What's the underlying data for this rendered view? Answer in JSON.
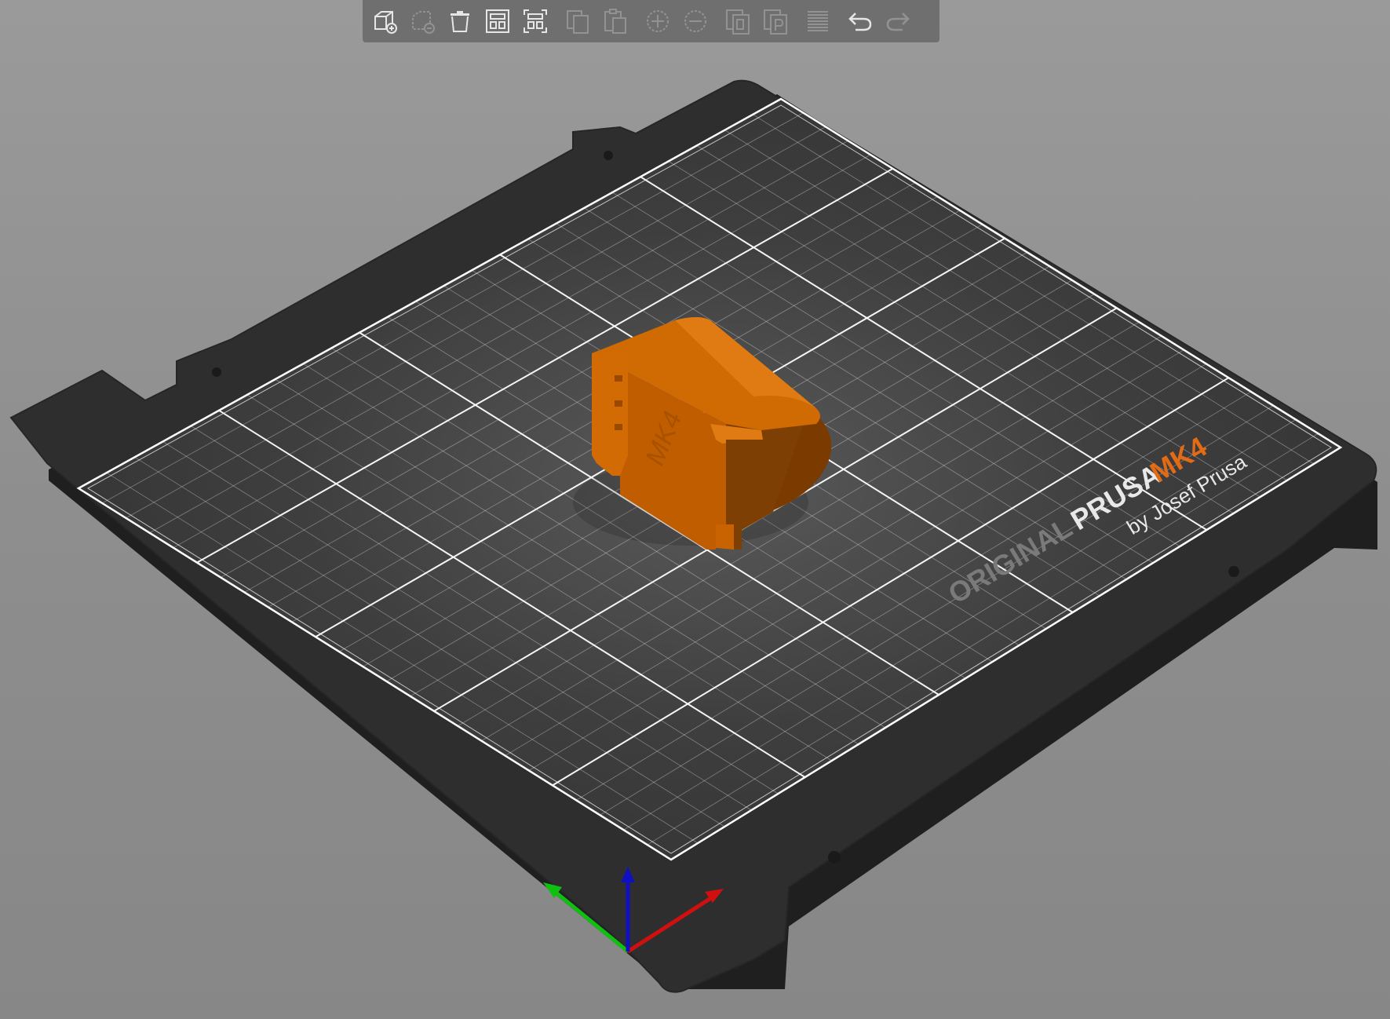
{
  "bed": {
    "brand_original": "ORIGINAL",
    "brand_prusa": "PRUSA",
    "brand_model": "MK4",
    "brand_by": "by Josef Prusa"
  },
  "model": {
    "label": "MK4",
    "color": "#d46a00"
  },
  "axes": {
    "x_color": "#d01010",
    "y_color": "#10c010",
    "z_color": "#1010c0"
  },
  "toolbar": {
    "buttons": [
      {
        "name": "add-object-icon",
        "enabled": true
      },
      {
        "name": "delete-icon",
        "enabled": false
      },
      {
        "name": "delete-all-icon",
        "enabled": true
      },
      {
        "name": "arrange-icon",
        "enabled": true
      },
      {
        "name": "arrange-selection-icon",
        "enabled": true
      },
      {
        "name": "copy-icon",
        "enabled": false
      },
      {
        "name": "paste-icon",
        "enabled": false
      },
      {
        "name": "add-instance-icon",
        "enabled": false
      },
      {
        "name": "remove-instance-icon",
        "enabled": false
      },
      {
        "name": "split-to-objects-icon",
        "enabled": false
      },
      {
        "name": "split-to-parts-icon",
        "enabled": false
      },
      {
        "name": "variable-layer-height-icon",
        "enabled": false
      },
      {
        "name": "undo-icon",
        "enabled": true
      },
      {
        "name": "redo-icon",
        "enabled": false
      }
    ]
  },
  "colors": {
    "bed_frame": "#2f2f2f",
    "bed_surface": "#3a3a3a",
    "grid_line": "#ffffff",
    "accent_orange": "#e36b16"
  }
}
